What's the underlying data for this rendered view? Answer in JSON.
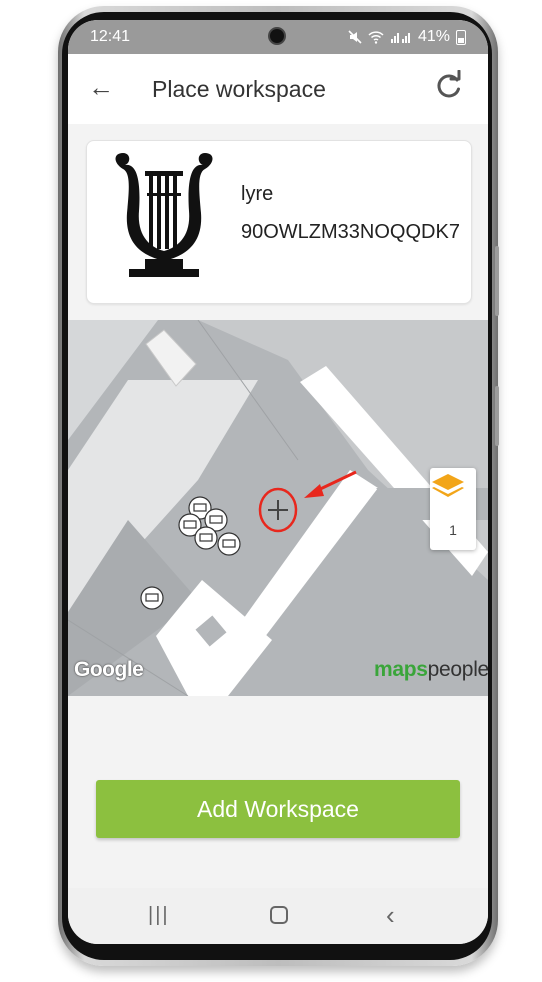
{
  "status_bar": {
    "time": "12:41",
    "battery": "41%"
  },
  "header": {
    "title": "Place workspace"
  },
  "workspace": {
    "name": "lyre",
    "code": "90OWLZM33NOQQDK7"
  },
  "map": {
    "floor": "1",
    "google_attribution": "Google",
    "brand_maps": "maps",
    "brand_people": "people"
  },
  "actions": {
    "add_label": "Add Workspace"
  },
  "colors": {
    "accent": "#8cc03f",
    "annotation": "#e8271d",
    "layers_icon": "#f2a519",
    "map_floor": "#b3b6b9"
  },
  "icons": {
    "back": "arrow-left-icon",
    "refresh": "refresh-icon",
    "layers": "layers-icon",
    "marker": "plus-icon",
    "desk": "desk-icon"
  }
}
